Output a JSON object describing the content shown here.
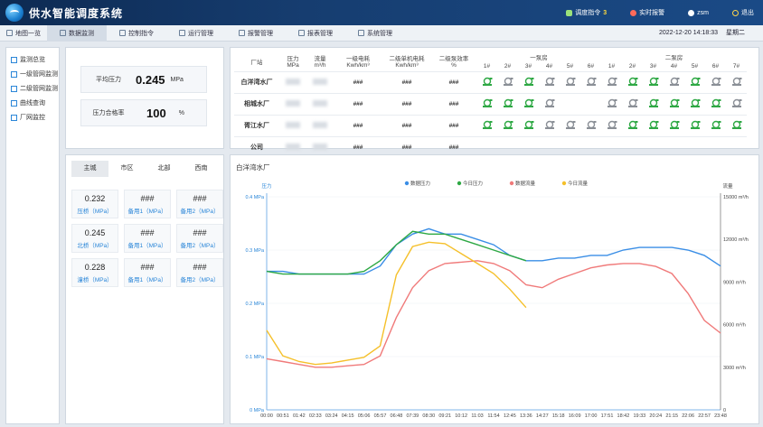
{
  "app": {
    "title": "供水智能调度系统"
  },
  "header": {
    "dispatch_label": "调度指令",
    "dispatch_count": "3",
    "alarm_label": "实时报警",
    "user_label": "zsm",
    "logout_label": "退出"
  },
  "nav": {
    "tabs": [
      "地图一览",
      "数据监测",
      "控制指令",
      "运行管理",
      "报警管理",
      "报表管理",
      "系统管理"
    ],
    "datetime": "2022-12-20 14:18:33",
    "weekday": "星期二"
  },
  "sidebar": {
    "items": [
      "监测总览",
      "一级管网监测",
      "二级管网监测",
      "曲线查询",
      "厂网监控"
    ]
  },
  "stats": {
    "avg_pressure_label": "平均压力",
    "avg_pressure_value": "0.245",
    "avg_pressure_unit": "MPa",
    "pass_rate_label": "压力合格率",
    "pass_rate_value": "100",
    "pass_rate_unit": "%"
  },
  "districts": {
    "tabs": [
      "主城",
      "市区",
      "北部",
      "西南"
    ],
    "cards": [
      {
        "value": "0.232",
        "label": "压桥（MPa）"
      },
      {
        "value": "###",
        "label": "备用1（MPa）"
      },
      {
        "value": "###",
        "label": "备用2（MPa）"
      },
      {
        "value": "0.245",
        "label": "北桥（MPa）"
      },
      {
        "value": "###",
        "label": "备用1（MPa）"
      },
      {
        "value": "###",
        "label": "备用2（MPa）"
      },
      {
        "value": "0.228",
        "label": "潼桥（MPa）"
      },
      {
        "value": "###",
        "label": "备用1（MPa）"
      },
      {
        "value": "###",
        "label": "备用2（MPa）"
      }
    ]
  },
  "stations": {
    "headers": [
      "厂站",
      "压力\nMPa",
      "流量\nm³/h",
      "一级电耗\nKwh/km³",
      "二级单机电耗\nKwh/km³",
      "二级泵效率\n%"
    ],
    "group1": "一泵房",
    "group2": "二泵房",
    "pump_labels_1": [
      "1#",
      "2#",
      "3#",
      "4#",
      "5#",
      "6#"
    ],
    "pump_labels_2": [
      "1#",
      "2#",
      "3#",
      "4#",
      "5#",
      "6#",
      "7#"
    ],
    "rows": [
      {
        "name": "白洋湾水厂",
        "e1": "###",
        "e2": "###",
        "eff": "###",
        "p1": [
          "on",
          "off",
          "on",
          "off",
          "off",
          "off"
        ],
        "p2": [
          "off",
          "on",
          "on",
          "off",
          "on",
          "off",
          "off"
        ]
      },
      {
        "name": "相城水厂",
        "e1": "###",
        "e2": "###",
        "eff": "###",
        "p1": [
          "on",
          "on",
          "on",
          "off",
          "",
          ""
        ],
        "p2": [
          "off",
          "off",
          "on",
          "on",
          "on",
          "on",
          "off"
        ]
      },
      {
        "name": "胥江水厂",
        "e1": "###",
        "e2": "###",
        "eff": "###",
        "p1": [
          "on",
          "on",
          "on",
          "off",
          "off",
          "off"
        ],
        "p2": [
          "off",
          "on",
          "on",
          "on",
          "on",
          "on",
          "on"
        ]
      },
      {
        "name": "公司",
        "e1": "###",
        "e2": "###",
        "eff": "###",
        "p1": [],
        "p2": []
      }
    ]
  },
  "chart_data": {
    "type": "line",
    "title": "白洋湾水厂",
    "ylabel": "压力",
    "y2label": "流量",
    "ylim": [
      0,
      0.4
    ],
    "y2lim": [
      0,
      15000
    ],
    "yticks": [
      "0 MPa",
      "0.1 MPa",
      "0.2 MPa",
      "0.3 MPa",
      "0.4 MPa"
    ],
    "y2ticks": [
      "0",
      "3000 m³/h",
      "6000 m³/h",
      "9000 m³/h",
      "12000 m³/h",
      "15000 m³/h"
    ],
    "categories": [
      "00:00",
      "00:51",
      "01:42",
      "02:33",
      "03:24",
      "04:15",
      "05:06",
      "05:57",
      "06:48",
      "07:39",
      "08:30",
      "09:21",
      "10:12",
      "11:03",
      "11:54",
      "12:45",
      "13:36",
      "14:27",
      "15:18",
      "16:09",
      "17:00",
      "17:51",
      "18:42",
      "19:33",
      "20:24",
      "21:15",
      "22:06",
      "22:57",
      "23:48"
    ],
    "legend": [
      "数据压力",
      "今日压力",
      "数据流量",
      "今日流量"
    ],
    "colors": {
      "p_hist": "#3a8ee6",
      "p_today": "#2ea844",
      "f_hist": "#f07a7a",
      "f_today": "#f5c02a"
    },
    "series": [
      {
        "name": "数据压力",
        "axis": "left",
        "values": [
          0.26,
          0.26,
          0.255,
          0.255,
          0.255,
          0.255,
          0.255,
          0.27,
          0.31,
          0.33,
          0.34,
          0.33,
          0.33,
          0.32,
          0.31,
          0.29,
          0.28,
          0.28,
          0.285,
          0.285,
          0.29,
          0.29,
          0.3,
          0.305,
          0.305,
          0.305,
          0.3,
          0.29,
          0.27
        ]
      },
      {
        "name": "今日压力",
        "axis": "left",
        "values": [
          0.26,
          0.255,
          0.255,
          0.255,
          0.255,
          0.255,
          0.26,
          0.28,
          0.31,
          0.335,
          0.33,
          0.33,
          0.32,
          0.31,
          0.3,
          0.29,
          0.28
        ]
      },
      {
        "name": "数据流量",
        "axis": "right",
        "values": [
          3600,
          3400,
          3200,
          3000,
          3000,
          3100,
          3200,
          3800,
          6500,
          8600,
          9800,
          10300,
          10400,
          10500,
          10300,
          9800,
          8800,
          8600,
          9200,
          9600,
          10000,
          10200,
          10300,
          10300,
          10100,
          9600,
          8200,
          6300,
          5400
        ]
      },
      {
        "name": "今日流量",
        "axis": "right",
        "values": [
          5600,
          3800,
          3400,
          3200,
          3300,
          3500,
          3700,
          4500,
          9500,
          11500,
          11800,
          11700,
          11000,
          10300,
          9600,
          8500,
          7200
        ]
      }
    ]
  }
}
